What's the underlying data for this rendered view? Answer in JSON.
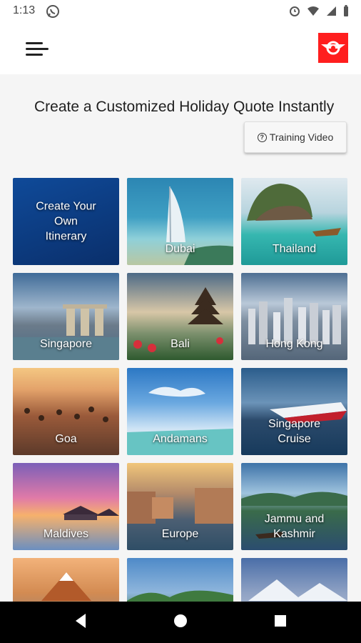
{
  "status": {
    "time": "1:13"
  },
  "header": {
    "menu_icon": "hamburger-menu-icon",
    "logo_icon": "brand-logo"
  },
  "main": {
    "title": "Create a Customized Holiday Quote Instantly",
    "training_button": {
      "label": "Training Video",
      "icon": "question-circle-icon"
    }
  },
  "tiles": [
    {
      "label": "Create Your\nOwn\nItinerary",
      "kind": "custom",
      "color": "#0d3f8a"
    },
    {
      "label": "Dubai",
      "kind": "photo",
      "color": "#2b6f90"
    },
    {
      "label": "Thailand",
      "kind": "photo",
      "color": "#35a7a9"
    },
    {
      "label": "Singapore",
      "kind": "photo",
      "color": "#5f7fa1"
    },
    {
      "label": "Bali",
      "kind": "photo",
      "color": "#6d8a6a"
    },
    {
      "label": "Hong Kong",
      "kind": "photo",
      "color": "#5f7590"
    },
    {
      "label": "Goa",
      "kind": "photo",
      "color": "#b86a3a"
    },
    {
      "label": "Andamans",
      "kind": "photo",
      "color": "#2f7ec2"
    },
    {
      "label": "Singapore\nCruise",
      "kind": "photo",
      "color": "#2a4a6e"
    },
    {
      "label": "Maldives",
      "kind": "photo",
      "color": "#9a5ab5"
    },
    {
      "label": "Europe",
      "kind": "photo",
      "color": "#6a7f8f"
    },
    {
      "label": "Jammu and\nKashmir",
      "kind": "photo",
      "color": "#4b6c8d"
    },
    {
      "label": "",
      "kind": "photo",
      "color": "#d38b52"
    },
    {
      "label": "",
      "kind": "photo",
      "color": "#4d8a4d"
    },
    {
      "label": "",
      "kind": "photo",
      "color": "#8fa2c4"
    }
  ],
  "nav": {
    "back_icon": "back-triangle-icon",
    "home_icon": "home-circle-icon",
    "recent_icon": "recent-square-icon"
  }
}
